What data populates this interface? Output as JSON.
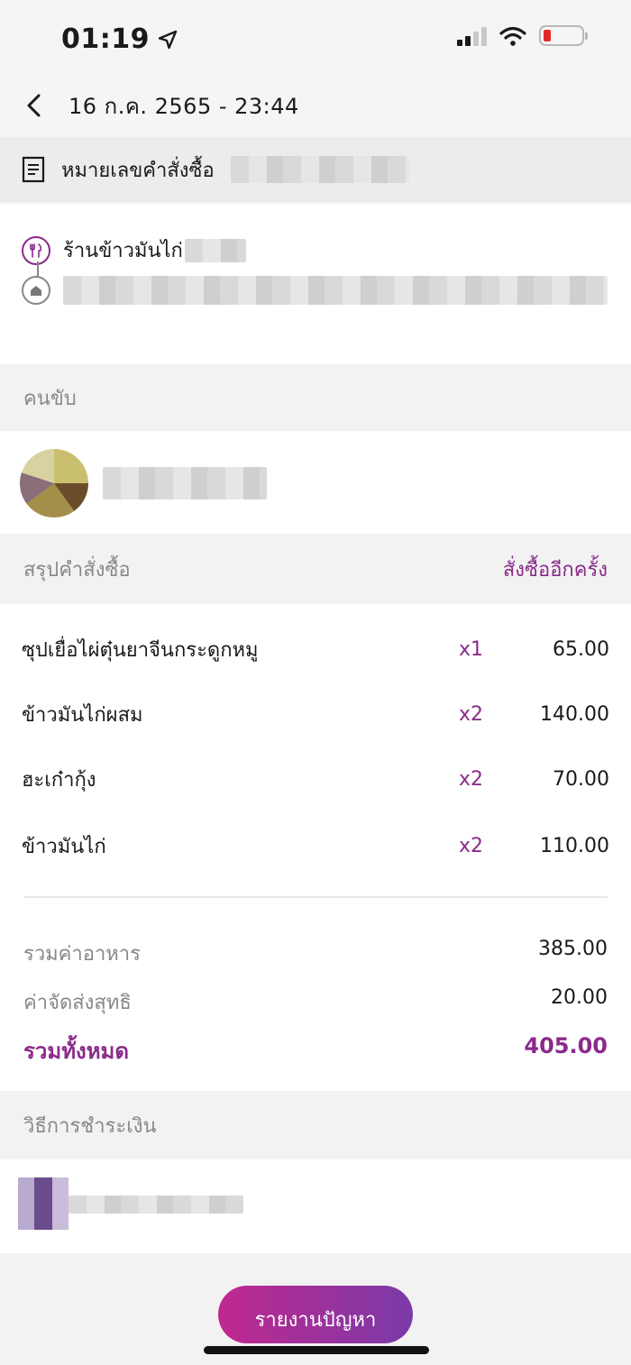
{
  "status_bar": {
    "time": "01:19"
  },
  "header": {
    "title": "16 ก.ค. 2565 - 23:44"
  },
  "order": {
    "number_label": "หมายเลขคำสั่งซื้อ"
  },
  "route": {
    "restaurant_name": "ร้านข้าวมันไก่"
  },
  "driver": {
    "section_title": "คนขับ"
  },
  "summary": {
    "section_title": "สรุปคำสั่งซื้อ",
    "reorder_label": "สั่งซื้ออีกครั้ง",
    "items": [
      {
        "name": "ซุปเยื่อไผ่ตุ๋นยาจีนกระดูกหมู",
        "qty": "x1",
        "price": "65.00"
      },
      {
        "name": "ข้าวมันไก่ผสม",
        "qty": "x2",
        "price": "140.00"
      },
      {
        "name": "ฮะเก๋ากุ้ง",
        "qty": "x2",
        "price": "70.00"
      },
      {
        "name": "ข้าวมันไก่",
        "qty": "x2",
        "price": "110.00"
      }
    ],
    "food_total_label": "รวมค่าอาหาร",
    "food_total": "385.00",
    "delivery_label": "ค่าจัดส่งสุทธิ",
    "delivery_fee": "20.00",
    "grand_total_label": "รวมทั้งหมด",
    "grand_total": "405.00"
  },
  "payment": {
    "section_title": "วิธีการชำระเงิน"
  },
  "actions": {
    "report_label": "รายงานปัญหา"
  },
  "colors": {
    "accent": "#8b2a8b",
    "button_gradient_start": "#c0288f",
    "button_gradient_end": "#7a3aa8"
  },
  "icons": [
    "location-arrow-icon",
    "signal-icon",
    "wifi-icon",
    "battery-icon",
    "back-chevron-icon",
    "document-icon",
    "restaurant-icon",
    "home-icon"
  ]
}
